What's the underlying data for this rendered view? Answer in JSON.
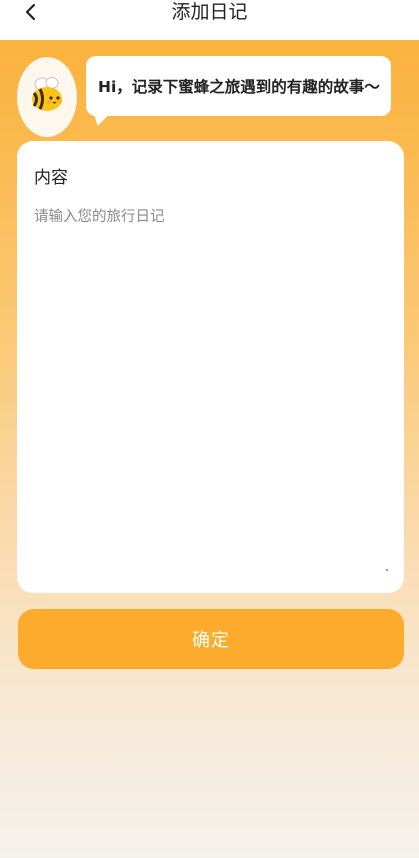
{
  "header": {
    "back_icon": "chevron-left-icon",
    "title": "添加日记"
  },
  "greeting": {
    "avatar_icon": "bee-icon",
    "message": "Hi，记录下蜜蜂之旅遇到的有趣的故事～"
  },
  "content": {
    "label": "内容",
    "placeholder": "请输入您的旅行日记",
    "value": ""
  },
  "actions": {
    "confirm_label": "确定"
  },
  "colors": {
    "accent": "#fdab2c",
    "gradient_top": "#fbb23d",
    "background_bottom": "#f5f1ec"
  }
}
